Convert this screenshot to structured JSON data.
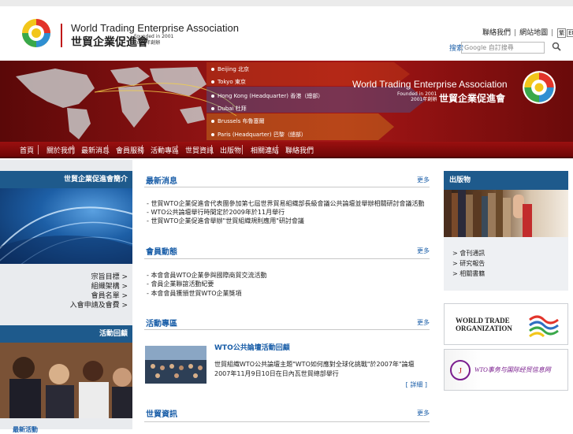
{
  "header": {
    "logo_en": "World Trading Enterprise Association",
    "logo_cn": "世貿企業促進會",
    "founded_en": "Founded in 2001",
    "founded_cn": "2001年創辦",
    "links": [
      "聯絡我們",
      "網站地圖",
      "繁"
    ],
    "lang_en": "EN",
    "search_label": "搜索",
    "search_placeholder": "Google 自訂搜尋"
  },
  "banner": {
    "cities": [
      "Beijing 北京",
      "Tokyo 東京",
      "Hong Kong (Headquarter) 香港（總部）",
      "Dubai 杜拜",
      "Brussels 布魯塞爾",
      "Paris (Headquarter) 巴黎（總部）"
    ],
    "title_en": "World Trading Enterprise Association",
    "founded_en": "Founded in 2001",
    "founded_cn": "2001年創辦",
    "title_cn": "世貿企業促進會"
  },
  "nav": [
    "首頁",
    "關於我們",
    "最新消息",
    "會員服務",
    "活動專區",
    "世貿資訊",
    "出版物",
    "相關連結",
    "聯絡我們"
  ],
  "left": {
    "section1_title": "世貿企業促進會簡介",
    "links": [
      "宗旨目標 >",
      "組織架構 >",
      "會員名單 >",
      "入會申請及會費 >"
    ],
    "section2_title": "活動回顧",
    "bottom_label": "最新活動"
  },
  "main": {
    "sections": [
      {
        "title": "最新消息",
        "more": "更多",
        "items": [
          "世貿WTO企業促進會代表團參加第七屆世界貿易組織部長級會議公共論壇並舉辦相關研討會議活動",
          "WTO公共論壇舉行時間定於2009年於11月舉行",
          "世貿WTO企業促進會舉辦\"世貿組織規則應用\"研討會議"
        ]
      },
      {
        "title": "會員動態",
        "more": "更多",
        "items": [
          "本會會員WTO企業參與國際商貿交流活動",
          "會員企業聯誼活動紀要",
          "本會會員獲頒世貿WTO企業獎項"
        ]
      },
      {
        "title": "活動專區",
        "more": "更多",
        "news_title": "WTO公共論壇活動回顧",
        "news_text": "世貿組織WTO公共論壇主題\"WTO如何應對全球化挑戰\"於2007年\"論壇2007年11月9日10日在日內瓦世貿總部舉行",
        "news_more": "[ 詳細 ]"
      },
      {
        "title": "世貿資訊",
        "more": "更多"
      }
    ]
  },
  "right": {
    "title": "出版物",
    "links": [
      "> 會刊通訊",
      "> 研究報告",
      "> 相關書籍"
    ],
    "wto_line1": "WORLD TRADE",
    "wto_line2": "ORGANIZATION",
    "wto2_text": "WTO事务与国际经贸信息网"
  }
}
